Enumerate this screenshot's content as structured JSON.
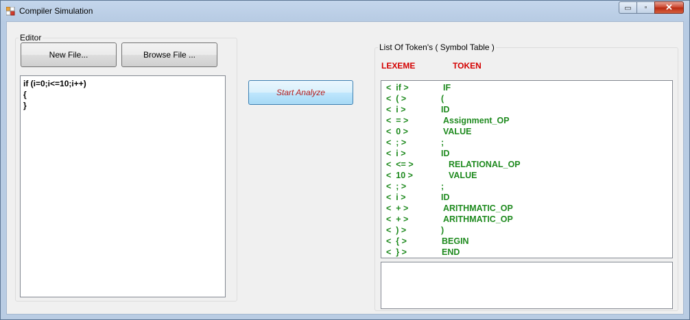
{
  "window": {
    "title": "Compiler Simulation",
    "controls": {
      "minimize": "▭",
      "maximize": "▫",
      "close": "✕"
    }
  },
  "editor": {
    "group_label": "Editor",
    "new_file_label": "New File...",
    "browse_file_label": "Browse File ...",
    "code": "if (i=0;i<=10;i++)\n{\n}"
  },
  "analyze_label": "Start Analyze",
  "symbol_table": {
    "group_label": "List Of Token's ( Symbol Table )",
    "header_lexeme": "LEXEME",
    "header_token": "TOKEN",
    "rows": [
      {
        "lexeme": "<  if >",
        "token": "IF"
      },
      {
        "lexeme": "<  ( >",
        "token": "("
      },
      {
        "lexeme": "<  i >",
        "token": "ID"
      },
      {
        "lexeme": "<  = >",
        "token": "Assignment_OP"
      },
      {
        "lexeme": "<  0 >",
        "token": "VALUE"
      },
      {
        "lexeme": "<  ; >",
        "token": ";"
      },
      {
        "lexeme": "<  i >",
        "token": "ID"
      },
      {
        "lexeme": "<  <= >",
        "token": "RELATIONAL_OP"
      },
      {
        "lexeme": "<  10 >",
        "token": "VALUE"
      },
      {
        "lexeme": "<  ; >",
        "token": ";"
      },
      {
        "lexeme": "<  i >",
        "token": "ID"
      },
      {
        "lexeme": "<  + >",
        "token": "ARITHMATIC_OP"
      },
      {
        "lexeme": "<  + >",
        "token": "ARITHMATIC_OP"
      },
      {
        "lexeme": "<  ) >",
        "token": ")"
      },
      {
        "lexeme": "<  { >",
        "token": "BEGIN"
      },
      {
        "lexeme": "<  } >",
        "token": "END"
      }
    ],
    "output_text": ""
  },
  "colors": {
    "header": "#d40000",
    "token_text": "#1e8a1e",
    "analyze_text": "#b51d1d"
  }
}
